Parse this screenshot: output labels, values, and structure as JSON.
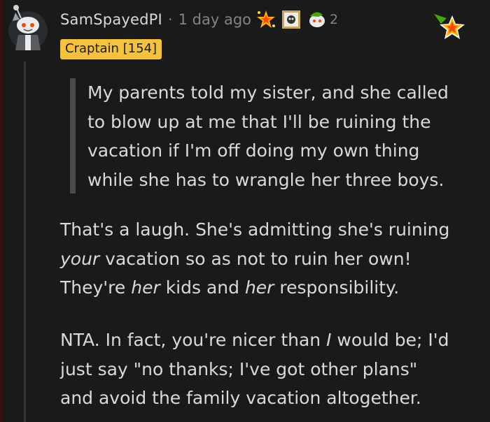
{
  "comment": {
    "username": "SamSpayedPI",
    "separator": "·",
    "time_ago": "1 day ago",
    "award_count": "2",
    "flair": "Craptain [154]",
    "quote_lines": [
      "My parents told my sister, and she called",
      "to blow up at me that I'll be ruining the",
      "vacation if I'm off doing my own thing",
      "while she has to wrangle her three boys."
    ],
    "paragraph1": {
      "line1": "That's a laugh. She's admitting she's ruining",
      "line2_em": "your",
      "line2_rest": " vacation so as not to ruin her own!",
      "line3_a": "They're ",
      "line3_em1": "her",
      "line3_b": " kids and ",
      "line3_em2": "her",
      "line3_c": " responsibility."
    },
    "paragraph2": {
      "line1_a": "NTA. In fact, you're nicer than ",
      "line1_em": "I",
      "line1_b": " would be; I'd",
      "line2": "just say \"no thanks; I've got other plans\"",
      "line3": "and avoid the family vacation altogether."
    }
  },
  "icons": {
    "avatar": "snoo-avatar",
    "award1": "sparkle-award-icon",
    "award2": "framed-award-icon",
    "award3": "snoo-award-icon",
    "badge": "gold-star-icon"
  },
  "colors": {
    "background": "#1a1a1b",
    "text": "#d7dadc",
    "muted": "#818384",
    "flair_bg": "#f5c33b"
  }
}
